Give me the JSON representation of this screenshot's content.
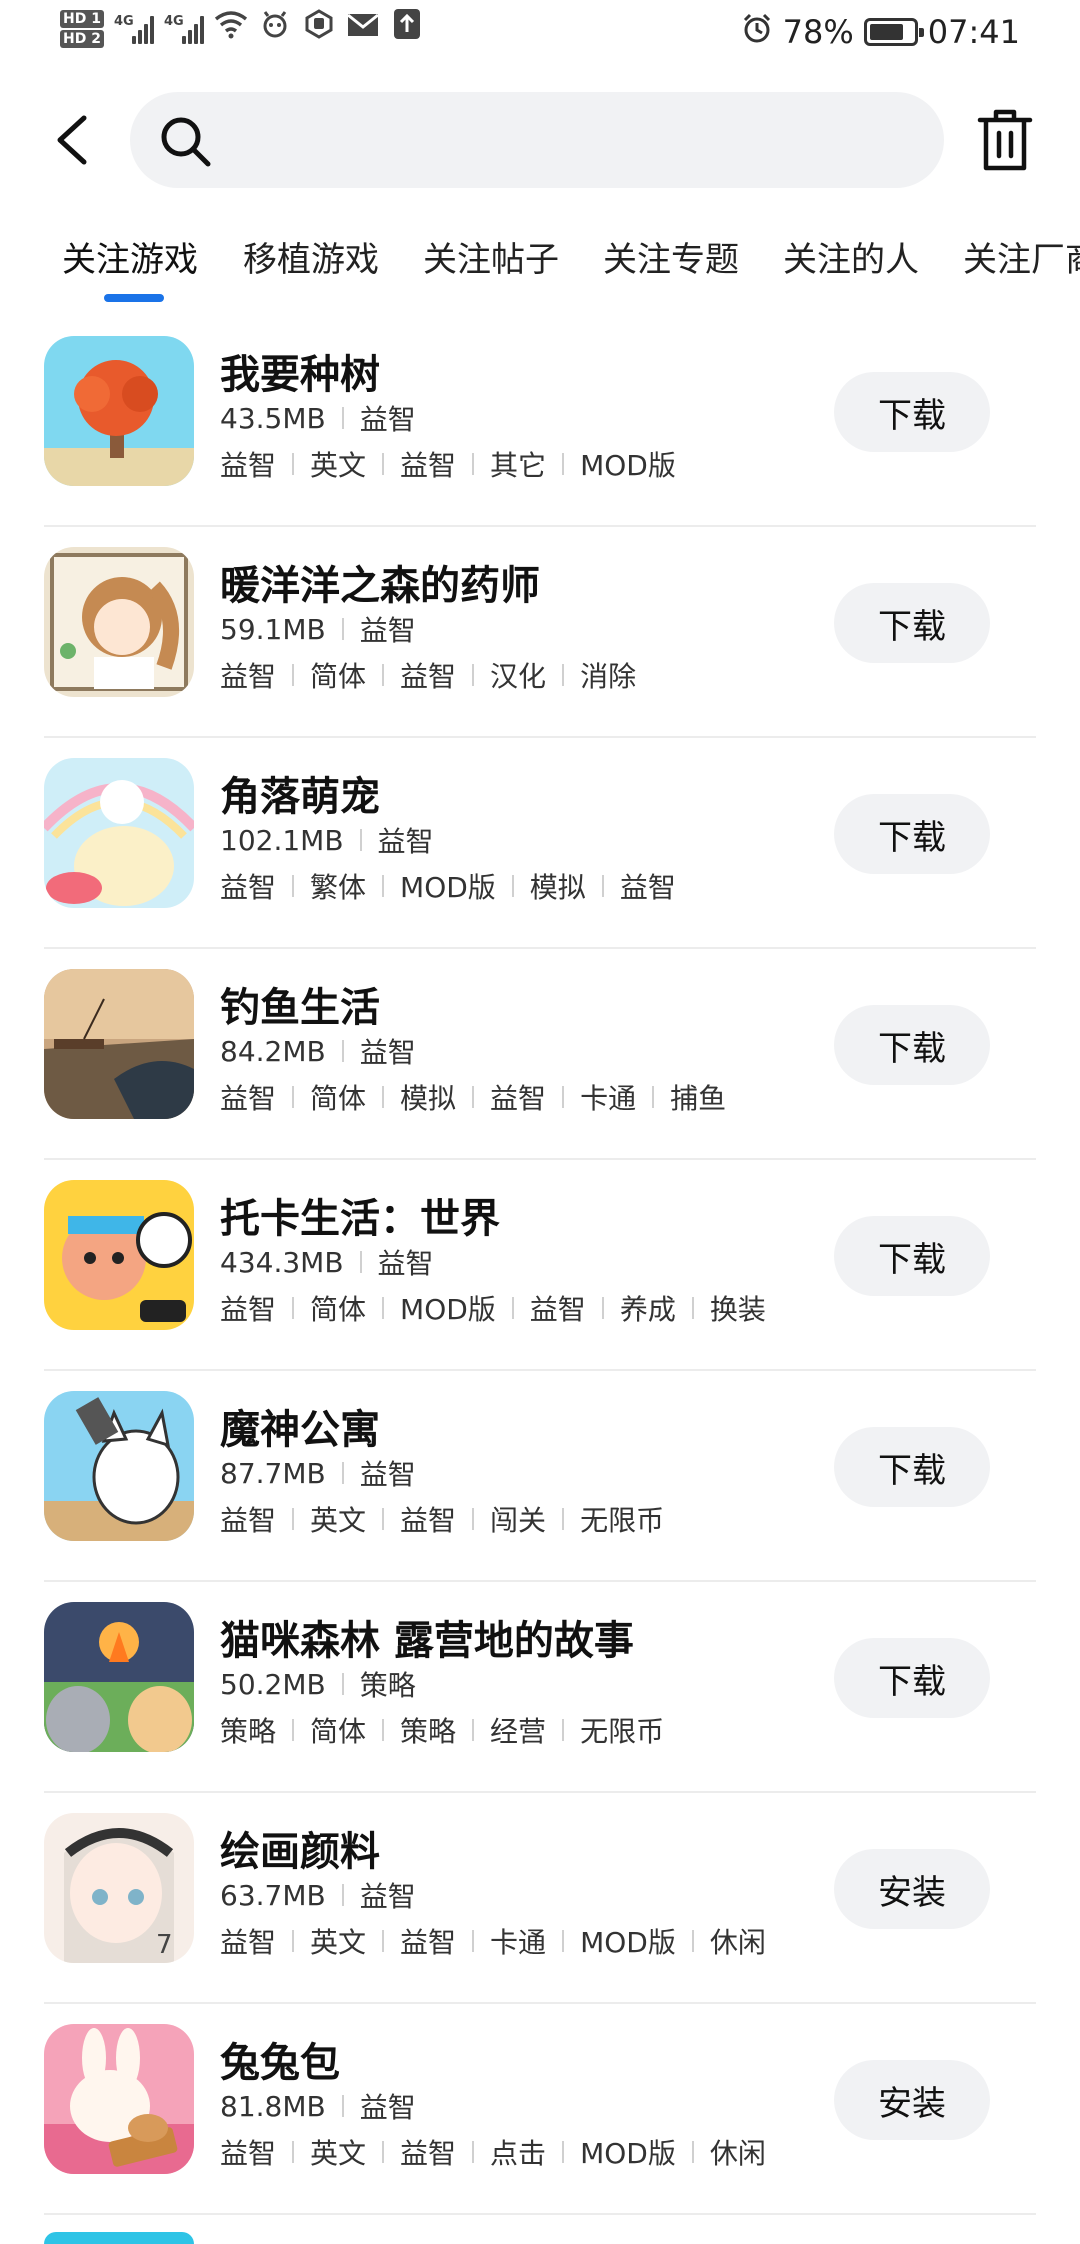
{
  "status": {
    "hd1": "HD 1",
    "hd2": "HD 2",
    "net1": "4G",
    "net2": "4G",
    "battery_pct": "78%",
    "battery_level": 0.78,
    "time": "07:41",
    "icons": [
      "wifi-icon",
      "face-icon",
      "hexagon-hand-icon",
      "mail-icon",
      "upload-icon",
      "alarm-icon"
    ]
  },
  "search": {
    "placeholder": "",
    "value": ""
  },
  "tabs": [
    {
      "label": "关注游戏",
      "active": true
    },
    {
      "label": "移植游戏"
    },
    {
      "label": "关注帖子"
    },
    {
      "label": "关注专题"
    },
    {
      "label": "关注的人"
    },
    {
      "label": "关注厂商"
    }
  ],
  "games": [
    {
      "title": "我要种树",
      "size": "43.5MB",
      "category": "益智",
      "tags": [
        "益智",
        "英文",
        "益智",
        "其它",
        "MOD版"
      ],
      "action": "下载"
    },
    {
      "title": "暖洋洋之森的药师",
      "size": "59.1MB",
      "category": "益智",
      "tags": [
        "益智",
        "简体",
        "益智",
        "汉化",
        "消除"
      ],
      "action": "下载"
    },
    {
      "title": "角落萌宠",
      "size": "102.1MB",
      "category": "益智",
      "tags": [
        "益智",
        "繁体",
        "MOD版",
        "模拟",
        "益智"
      ],
      "action": "下载"
    },
    {
      "title": "钓鱼生活",
      "size": "84.2MB",
      "category": "益智",
      "tags": [
        "益智",
        "简体",
        "模拟",
        "益智",
        "卡通",
        "捕鱼"
      ],
      "action": "下载"
    },
    {
      "title": "托卡生活：世界",
      "size": "434.3MB",
      "category": "益智",
      "tags": [
        "益智",
        "简体",
        "MOD版",
        "益智",
        "养成",
        "换装"
      ],
      "action": "下载"
    },
    {
      "title": "魔神公寓",
      "size": "87.7MB",
      "category": "益智",
      "tags": [
        "益智",
        "英文",
        "益智",
        "闯关",
        "无限币"
      ],
      "action": "下载"
    },
    {
      "title": "猫咪森林 露营地的故事",
      "size": "50.2MB",
      "category": "策略",
      "tags": [
        "策略",
        "简体",
        "策略",
        "经营",
        "无限币"
      ],
      "action": "下载"
    },
    {
      "title": "绘画颜料",
      "size": "63.7MB",
      "category": "益智",
      "tags": [
        "益智",
        "英文",
        "益智",
        "卡通",
        "MOD版",
        "休闲"
      ],
      "action": "安装"
    },
    {
      "title": "兔兔包",
      "size": "81.8MB",
      "category": "益智",
      "tags": [
        "益智",
        "英文",
        "益智",
        "点击",
        "MOD版",
        "休闲"
      ],
      "action": "安装"
    }
  ]
}
